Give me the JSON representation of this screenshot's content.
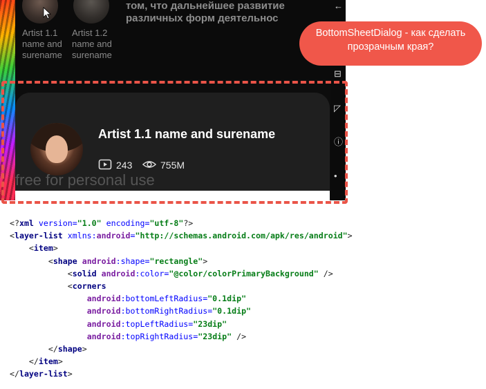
{
  "phone": {
    "artists_small": [
      {
        "label": "Artist 1.1 name and surename"
      },
      {
        "label": "Artist 1.2 name and surename"
      }
    ],
    "description": "том, что дальнейшее развитие различных форм деятельнос",
    "side_icons": [
      "←",
      "⊟",
      "◸",
      "ⓘ",
      "•"
    ],
    "sheet": {
      "title": "Artist 1.1 name and surename",
      "videos_count": "243",
      "views_count": "755M",
      "watermark": "free for personal use"
    }
  },
  "callout": {
    "text": "BottomSheetDialog - как сделать прозрачным края?",
    "color": "#f0574a"
  },
  "code": {
    "lines": [
      {
        "indent": "",
        "tokens": [
          [
            "decl",
            "<?"
          ],
          [
            "tag",
            "xml "
          ],
          [
            "attr",
            "version="
          ],
          [
            "str",
            "\"1.0\" "
          ],
          [
            "attr",
            "encoding="
          ],
          [
            "str",
            "\"utf-8\""
          ],
          [
            "decl",
            "?>"
          ]
        ]
      },
      {
        "indent": "",
        "tokens": [
          [
            "bracket",
            "<"
          ],
          [
            "tag",
            "layer-list "
          ],
          [
            "attr",
            "xmlns:"
          ],
          [
            "attr-ns",
            "android"
          ],
          [
            "attr",
            "="
          ],
          [
            "str",
            "\"http://schemas.android.com/apk/res/android\""
          ],
          [
            "bracket",
            ">"
          ]
        ]
      },
      {
        "indent": "    ",
        "tokens": [
          [
            "bracket",
            "<"
          ],
          [
            "tag",
            "item"
          ],
          [
            "bracket",
            ">"
          ]
        ]
      },
      {
        "indent": "        ",
        "tokens": [
          [
            "bracket",
            "<"
          ],
          [
            "tag",
            "shape "
          ],
          [
            "attr-ns",
            "android"
          ],
          [
            "attr",
            ":shape="
          ],
          [
            "str",
            "\"rectangle\""
          ],
          [
            "bracket",
            ">"
          ]
        ]
      },
      {
        "indent": "            ",
        "tokens": [
          [
            "bracket",
            "<"
          ],
          [
            "tag",
            "solid "
          ],
          [
            "attr-ns",
            "android"
          ],
          [
            "attr",
            ":color="
          ],
          [
            "str",
            "\"@color/colorPrimaryBackground\" "
          ],
          [
            "bracket",
            "/>"
          ]
        ]
      },
      {
        "indent": "            ",
        "tokens": [
          [
            "bracket",
            "<"
          ],
          [
            "tag",
            "corners"
          ]
        ]
      },
      {
        "indent": "                ",
        "tokens": [
          [
            "attr-ns",
            "android"
          ],
          [
            "attr",
            ":bottomLeftRadius="
          ],
          [
            "str",
            "\"0.1dip\""
          ]
        ]
      },
      {
        "indent": "                ",
        "tokens": [
          [
            "attr-ns",
            "android"
          ],
          [
            "attr",
            ":bottomRightRadius="
          ],
          [
            "str",
            "\"0.1dip\""
          ]
        ]
      },
      {
        "indent": "                ",
        "tokens": [
          [
            "attr-ns",
            "android"
          ],
          [
            "attr",
            ":topLeftRadius="
          ],
          [
            "str",
            "\"23dip\""
          ]
        ]
      },
      {
        "indent": "                ",
        "tokens": [
          [
            "attr-ns",
            "android"
          ],
          [
            "attr",
            ":topRightRadius="
          ],
          [
            "str",
            "\"23dip\" "
          ],
          [
            "bracket",
            "/>"
          ]
        ]
      },
      {
        "indent": "        ",
        "tokens": [
          [
            "bracket",
            "</"
          ],
          [
            "tag",
            "shape"
          ],
          [
            "bracket",
            ">"
          ]
        ]
      },
      {
        "indent": "    ",
        "tokens": [
          [
            "bracket",
            "</"
          ],
          [
            "tag",
            "item"
          ],
          [
            "bracket",
            ">"
          ]
        ]
      },
      {
        "indent": "",
        "tokens": [
          [
            "bracket",
            "</"
          ],
          [
            "tag",
            "layer-list"
          ],
          [
            "bracket",
            ">"
          ]
        ]
      }
    ]
  }
}
